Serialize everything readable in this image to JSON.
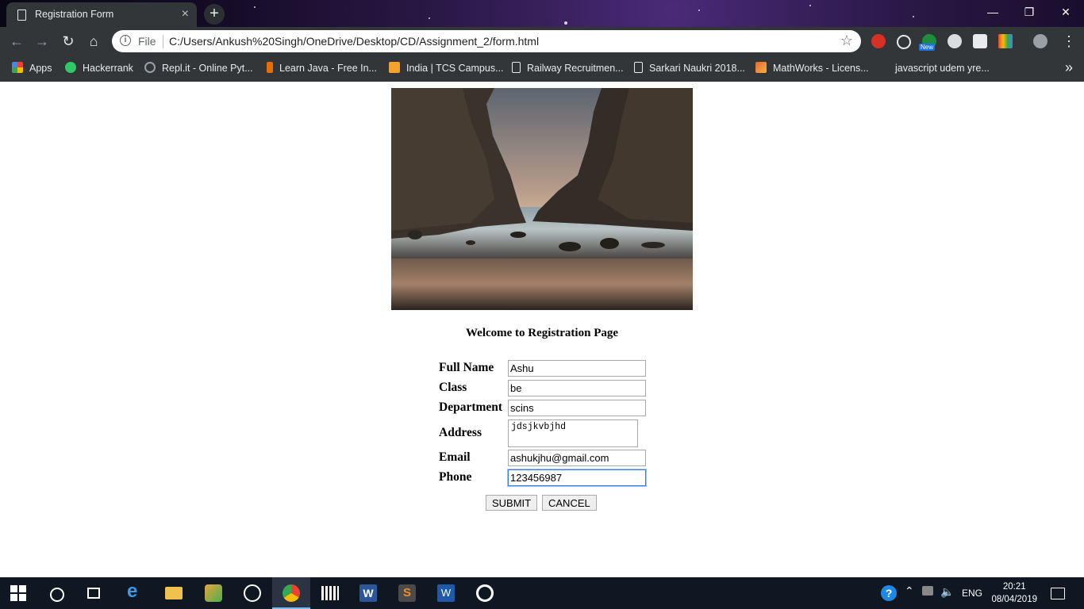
{
  "browser": {
    "tab_title": "Registration Form",
    "tab_close": "×",
    "new_tab": "+",
    "scheme_label": "File",
    "url": "C:/Users/Ankush%20Singh/OneDrive/Desktop/CD/Assignment_2/form.html",
    "bookmarks": [
      {
        "label": "Apps",
        "icon": "apps-grid-icon",
        "color": "#e8453c"
      },
      {
        "label": "Hackerrank",
        "icon": "hackerrank-icon",
        "color": "#2ec866"
      },
      {
        "label": "Repl.it - Online Pyt...",
        "icon": "replit-icon",
        "color": "#9aa0a6"
      },
      {
        "label": "Learn Java - Free In...",
        "icon": "java-icon",
        "color": "#e76f00"
      },
      {
        "label": "India | TCS Campus...",
        "icon": "tcs-icon",
        "color": "#f4a22d"
      },
      {
        "label": "Railway Recruitmen...",
        "icon": "page-icon",
        "color": "#e8eaed"
      },
      {
        "label": "Sarkari Naukri 2018...",
        "icon": "page-icon",
        "color": "#e8eaed"
      },
      {
        "label": "MathWorks - Licens...",
        "icon": "matlab-icon",
        "color": "#e16737"
      },
      {
        "label": "javascript udem yre...",
        "icon": "blank-icon",
        "color": "#323639"
      }
    ],
    "ext_new_badge": "New"
  },
  "page": {
    "heading": "Welcome to Registration Page",
    "form": {
      "full_name_label": "Full Name",
      "full_name_value": "Ashu",
      "class_label": "Class",
      "class_value": "be",
      "department_label": "Department",
      "department_value": "scins",
      "address_label": "Address",
      "address_value": "jdsjkvbjhd",
      "email_label": "Email",
      "email_value": "ashukjhu@gmail.com",
      "phone_label": "Phone",
      "phone_value": "123456987",
      "submit_label": "SUBMIT",
      "cancel_label": "CANCEL"
    }
  },
  "taskbar": {
    "language": "ENG",
    "time": "20:21",
    "date": "08/04/2019"
  }
}
